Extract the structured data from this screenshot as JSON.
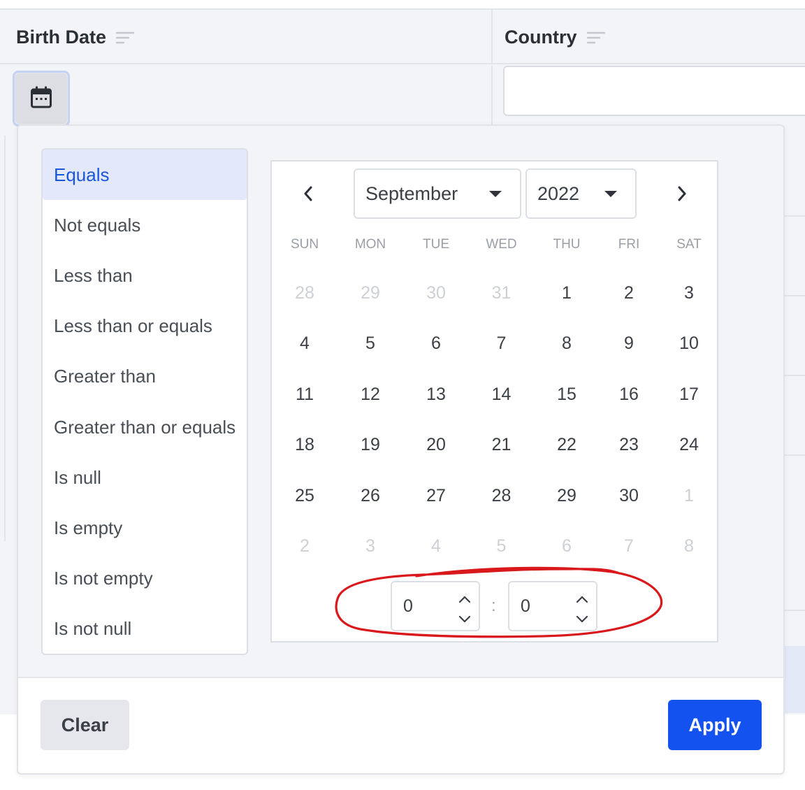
{
  "columns": [
    {
      "title": "Birth Date"
    },
    {
      "title": "Country"
    }
  ],
  "filter": {
    "operators": [
      "Equals",
      "Not equals",
      "Less than",
      "Less than or equals",
      "Greater than",
      "Greater than or equals",
      "Is null",
      "Is empty",
      "Is not empty",
      "Is not null"
    ],
    "selected_operator": "Equals"
  },
  "calendar": {
    "month": "September",
    "year": "2022",
    "weekdays": [
      "SUN",
      "MON",
      "TUE",
      "WED",
      "THU",
      "FRI",
      "SAT"
    ],
    "weeks": [
      [
        "28",
        "29",
        "30",
        "31",
        "1",
        "2",
        "3"
      ],
      [
        "4",
        "5",
        "6",
        "7",
        "8",
        "9",
        "10"
      ],
      [
        "11",
        "12",
        "13",
        "14",
        "15",
        "16",
        "17"
      ],
      [
        "18",
        "19",
        "20",
        "21",
        "22",
        "23",
        "24"
      ],
      [
        "25",
        "26",
        "27",
        "28",
        "29",
        "30",
        "1"
      ],
      [
        "2",
        "3",
        "4",
        "5",
        "6",
        "7",
        "8"
      ]
    ],
    "time": {
      "hour": "0",
      "separator": ":",
      "minute": "0"
    }
  },
  "buttons": {
    "clear": "Clear",
    "apply": "Apply"
  },
  "colors": {
    "accent": "#1452f0",
    "annotation": "#d9181c",
    "active_bg": "#e3e9fb"
  }
}
